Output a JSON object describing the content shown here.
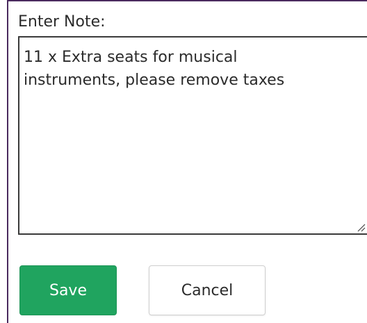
{
  "form": {
    "label": "Enter Note:",
    "note_value": "11 x Extra seats for musical\ninstruments, please remove taxes",
    "resize_icon": "resize-grip-icon"
  },
  "buttons": {
    "save_label": "Save",
    "cancel_label": "Cancel"
  },
  "colors": {
    "save_bg": "#20a45f",
    "frame_border": "#4a2a5e"
  }
}
